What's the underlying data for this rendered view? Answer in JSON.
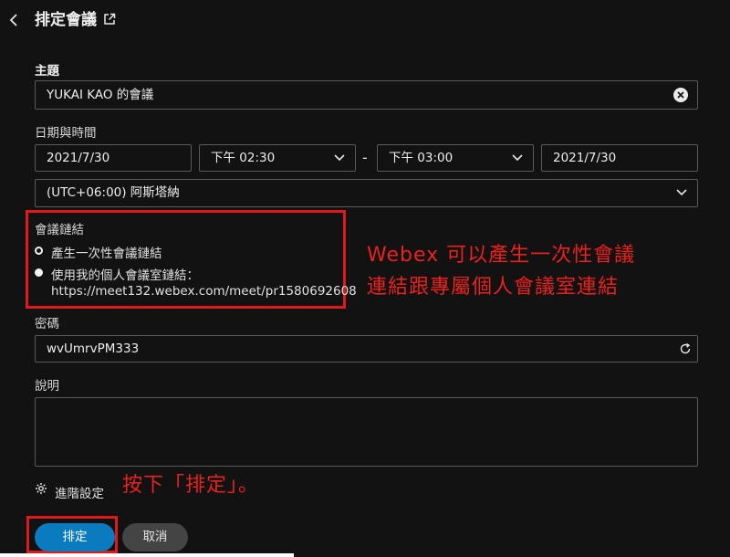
{
  "header": {
    "title": "排定會議"
  },
  "topic": {
    "label": "主題",
    "value": "YUKAI KAO 的會議"
  },
  "datetime": {
    "label": "日期與時間",
    "start_date": "2021/7/30",
    "start_time": "下午 02:30",
    "separator": "-",
    "end_time": "下午 03:00",
    "end_date": "2021/7/30",
    "timezone": "(UTC+06:00) 阿斯塔納"
  },
  "meeting_link": {
    "label": "會議鏈結",
    "options": [
      {
        "label": "產生一次性會議鏈結",
        "checked": true
      },
      {
        "label": "使用我的個人會議室鏈結：",
        "checked": false
      }
    ],
    "personal_room_url": "https://meet132.webex.com/meet/pr1580692608"
  },
  "password": {
    "label": "密碼",
    "value": "wvUmrvPM333"
  },
  "description": {
    "label": "說明",
    "value": ""
  },
  "advanced": {
    "label": "進階設定"
  },
  "buttons": {
    "schedule": "排定",
    "cancel": "取消"
  },
  "annotations": {
    "link_note_line1": "Webex 可以產生一次性會議",
    "link_note_line2": "連結跟專屬個人會議室連結",
    "schedule_note": "按下「排定」。"
  },
  "colors": {
    "background": "#121212",
    "annotation_red": "#e8221f",
    "primary_button": "#0a7bbf",
    "secondary_button": "#444444"
  },
  "icons": {
    "back": "chevron-left-icon",
    "popout": "external-link-icon",
    "clear": "clear-circle-icon",
    "dropdown": "chevron-down-icon",
    "refresh": "refresh-icon",
    "settings": "gear-icon"
  }
}
